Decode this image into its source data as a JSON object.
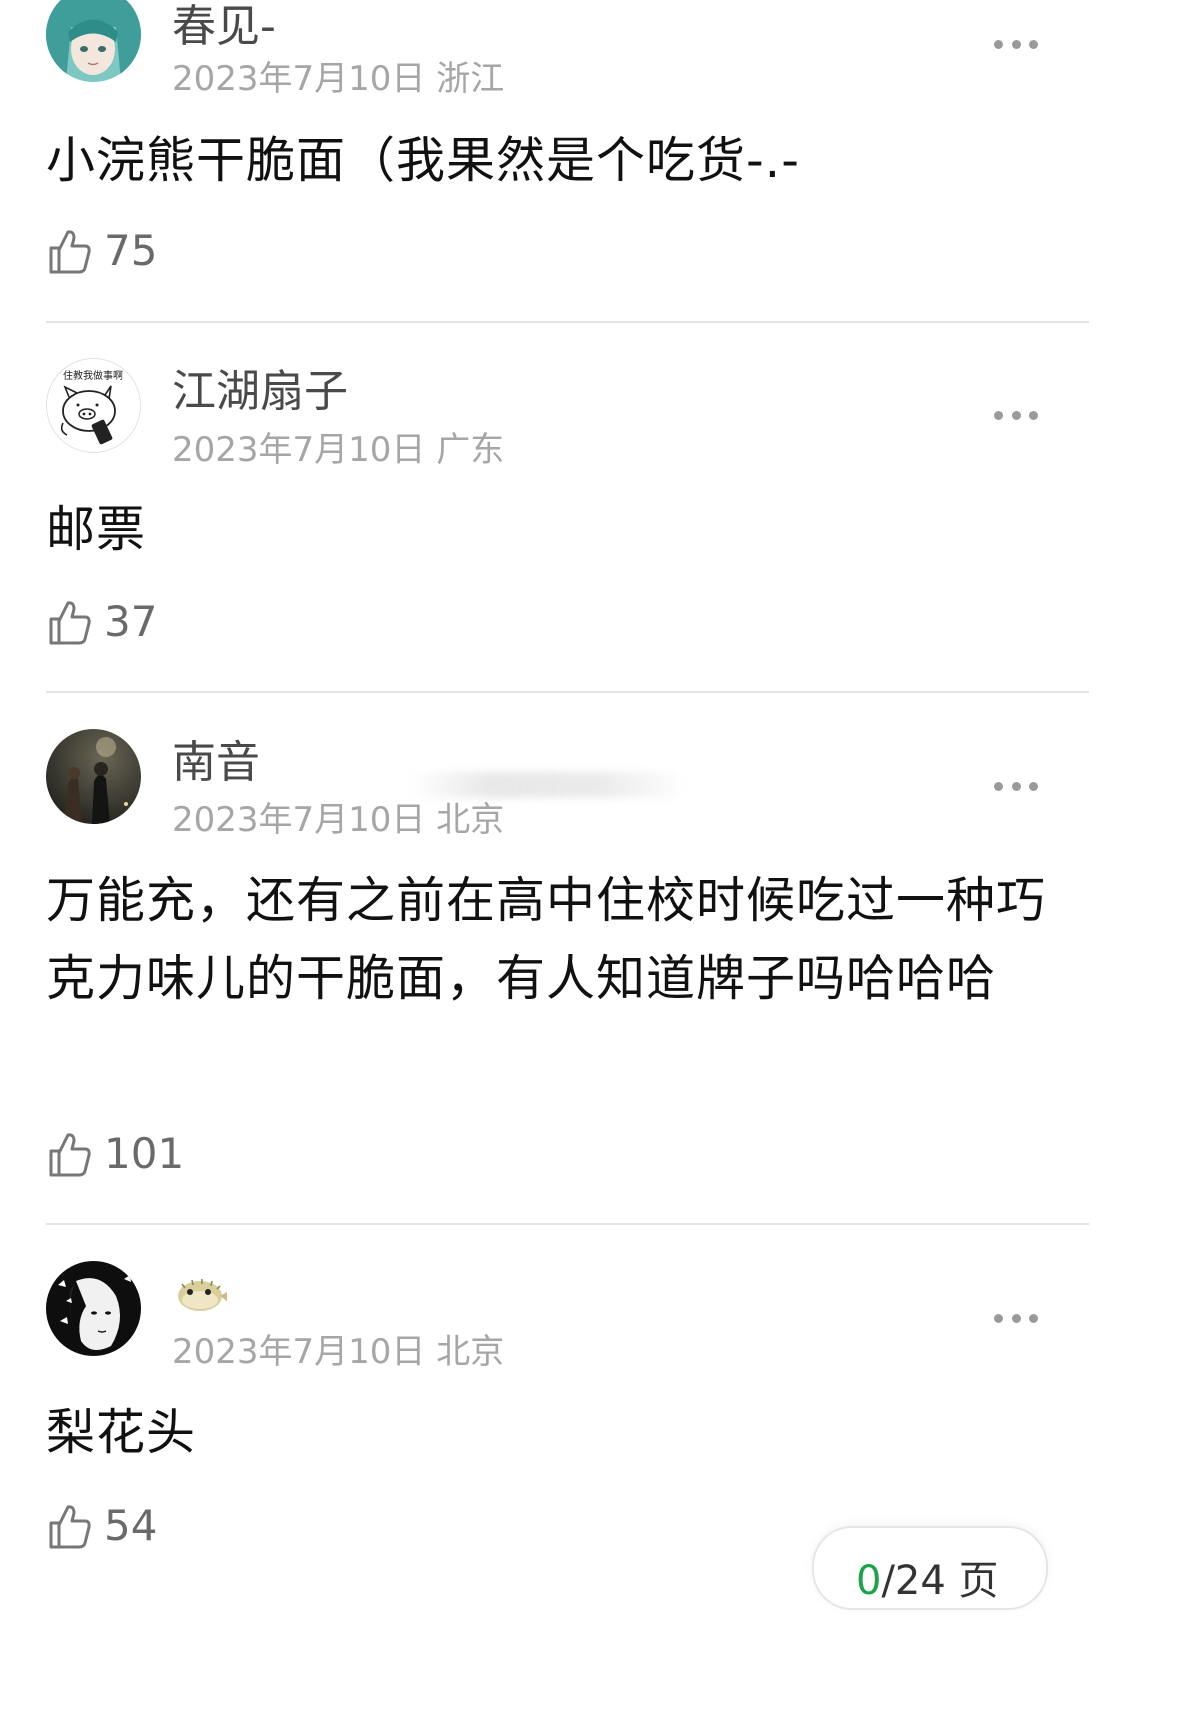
{
  "comments": [
    {
      "username": "春见-",
      "meta": "2023年7月10日 浙江",
      "text": "小浣熊干脆面（我果然是个吃货-.-",
      "likes": "75",
      "avatar_icon": "anime-girl-avatar"
    },
    {
      "username": "江湖扇子",
      "meta": "2023年7月10日 广东",
      "text": "邮票",
      "likes": "37",
      "avatar_icon": "pig-sketch-avatar",
      "avatar_caption": "住教我做事啊"
    },
    {
      "username": "南音",
      "meta": "2023年7月10日 北京",
      "text": "万能充，还有之前在高中住校时候吃过一种巧克力味儿的干脆面，有人知道牌子吗哈哈哈",
      "likes": "101",
      "avatar_icon": "night-photo-avatar"
    },
    {
      "username": "",
      "meta": "2023年7月10日 北京",
      "text": "梨花头",
      "likes": "54",
      "avatar_icon": "butterfly-girl-avatar",
      "name_icon": "pufferfish-icon"
    }
  ],
  "pager": {
    "current": "0",
    "rest": "/24 页"
  },
  "colors": {
    "meta": "#a6a6a6",
    "username": "#4a4a4a",
    "divider": "#e4e4e4",
    "pager_accent": "#1aa34a"
  }
}
